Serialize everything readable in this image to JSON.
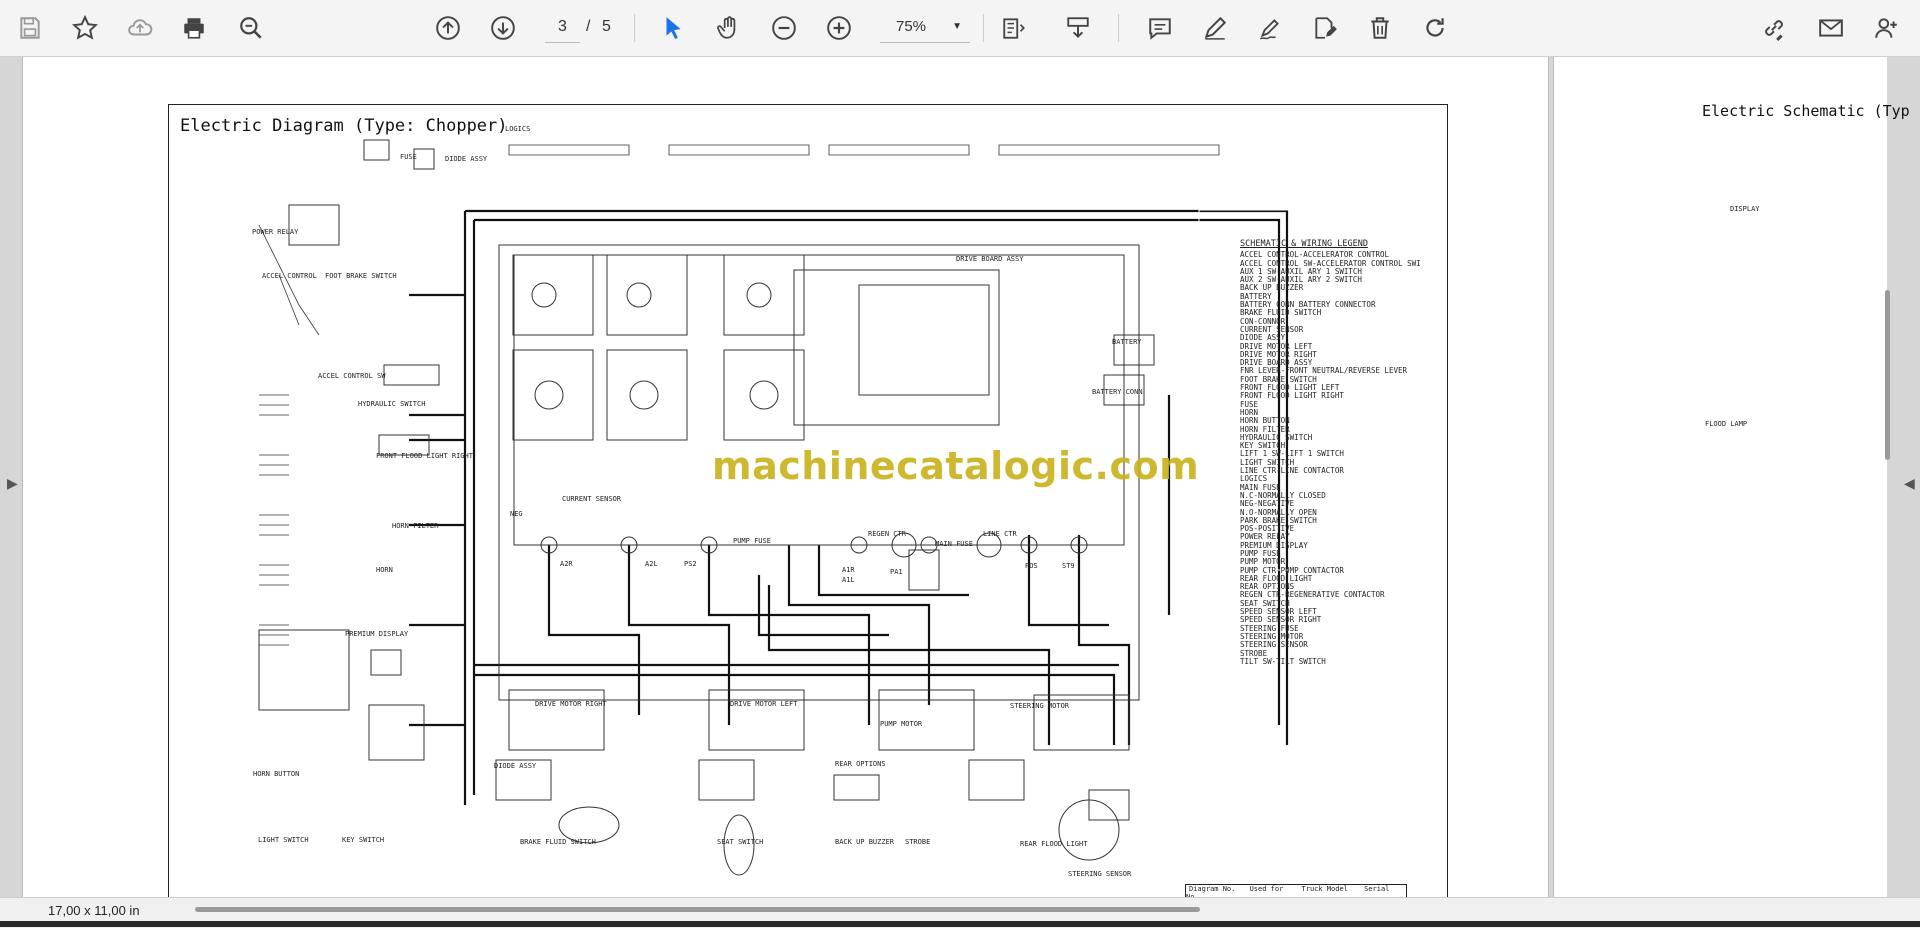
{
  "toolbar": {
    "page_current": "3",
    "page_separator": "/",
    "page_total": "5",
    "zoom_value": "75%",
    "icons": [
      "save-icon",
      "bookmark-star-icon",
      "upload-cloud-icon",
      "print-icon",
      "zoom-search-icon",
      "prev-page-icon",
      "next-page-icon",
      "select-cursor-icon",
      "hand-pan-icon",
      "zoom-out-icon",
      "zoom-in-icon",
      "page-fit-icon",
      "download-tray-icon",
      "comment-icon",
      "pen-icon",
      "signature-icon",
      "edit-doc-icon",
      "trash-icon",
      "redo-icon",
      "link-share-icon",
      "mail-icon",
      "user-add-icon"
    ]
  },
  "document": {
    "main_title": "Electric Diagram (Type: Chopper)",
    "right_title": "Electric Schematic (Typ",
    "watermark": "machinecatalogic.com",
    "legend_heading": "SCHEMATIC & WIRING LEGEND",
    "legend_items": [
      "ACCEL CONTROL-ACCELERATOR CONTROL",
      "ACCEL CONTROL SW-ACCELERATOR CONTROL SWITCH",
      "AUX 1 SW-AUXIL ARY 1 SWITCH",
      "AUX 2 SW-AUXIL ARY 2 SWITCH",
      "BACK UP BUZZER",
      "BATTERY",
      "BATTERY CONN BATTERY CONNECTOR",
      "BRAKE FLUID SWITCH",
      "CON-CONNOR",
      "CURRENT SENSOR",
      "DIODE ASSY",
      "DRIVE MOTOR LEFT",
      "DRIVE MOTOR RIGHT",
      "DRIVE BOARD ASSY",
      "FNR LEVER-FRONT NEUTRAL/REVERSE LEVER",
      "FOOT BRAKE SWITCH",
      "FRONT FLOOD LIGHT LEFT",
      "FRONT FLOOD LIGHT RIGHT",
      "FUSE",
      "HORN",
      "HORN BUTTON",
      "HORN FILTER",
      "HYDRAULIC SWITCH",
      "KEY SWITCH",
      "LIFT 1 SW-LIFT 1 SWITCH",
      "LIGHT SWITCH",
      "LINE CTR-LINE CONTACTOR",
      "LOGICS",
      "MAIN FUSE",
      "N.C-NORMALLY CLOSED",
      "NEG-NEGATIVE",
      "N.O-NORMALLY OPEN",
      "PARK BRAKE SWITCH",
      "POS-POSITIVE",
      "POWER RELAY",
      "PREMIUM DISPLAY",
      "PUMP FUSE",
      "PUMP MOTOR",
      "PUMP CTR-PUMP CONTACTOR",
      "REAR FLOOD LIGHT",
      "REAR OPTIONS",
      "REGEN CTR-REGENERATIVE CONTACTOR",
      "SEAT SWITCH",
      "SPEED SENSOR LEFT",
      "SPEED SENSOR RIGHT",
      "STEERING FUSE",
      "STEERING MOTOR",
      "STEERING SENSOR",
      "STROBE",
      "TILT SW-TILT SWITCH"
    ],
    "labels": {
      "power_relay": "POWER RELAY",
      "fuse": "FUSE",
      "diode_assy": "DIODE ASSY",
      "logics": "LOGICS",
      "accel_control": "ACCEL CONTROL",
      "foot_brake_switch": "FOOT BRAKE SWITCH",
      "accel_control_sw": "ACCEL CONTROL SW",
      "hydraulic_switch": "HYDRAULIC SWITCH",
      "front_flood_light_right": "FRONT FLOOD LIGHT RIGHT",
      "horn_filter": "HORN FILTER",
      "horn": "HORN",
      "premium_display": "PREMIUM DISPLAY",
      "horn_button": "HORN BUTTON",
      "light_switch": "LIGHT SWITCH",
      "key_switch": "KEY SWITCH",
      "drive_board_assy": "DRIVE BOARD ASSY",
      "battery": "BATTERY",
      "battery_conn": "BATTERY CONN",
      "current_sensor": "CURRENT SENSOR",
      "pump_fuse": "PUMP FUSE",
      "regen_ctr": "REGEN CTR",
      "main_fuse": "MAIN FUSE",
      "line_ctr": "LINE CTR",
      "neg": "NEG",
      "pos": "POS",
      "a2r": "A2R",
      "a2l": "A2L",
      "ps2": "PS2",
      "a1r": "A1R",
      "a1l": "A1L",
      "pa1": "PA1",
      "st9": "ST9",
      "drive_motor_right": "DRIVE MOTOR RIGHT",
      "drive_motor_left": "DRIVE MOTOR LEFT",
      "pump_motor": "PUMP MOTOR",
      "steering_motor": "STEERING MOTOR",
      "rear_options": "REAR OPTIONS",
      "diode_assy_2": "DIODE ASSY",
      "brake_fluid_switch": "BRAKE FLUID SWITCH",
      "seat_switch": "SEAT SWITCH",
      "back_up_buzzer": "BACK UP BUZZER",
      "strobe": "STROBE",
      "rear_flood_light": "REAR FLOOD LIGHT",
      "steering_sensor": "STEERING SENSOR",
      "diagram_no": "Diagram No.",
      "used_for": "Used for",
      "truck_model": "Truck Model",
      "serial_no": "Serial No.",
      "right_display": "DISPLAY",
      "right_flood": "FLOOD LAMP"
    }
  },
  "status": {
    "page_size": "17,00 x 11,00 in"
  },
  "colors": {
    "toolbar_bg": "#f4f4f4",
    "accent_blue": "#1a73e8",
    "watermark": "#c9b11a"
  }
}
